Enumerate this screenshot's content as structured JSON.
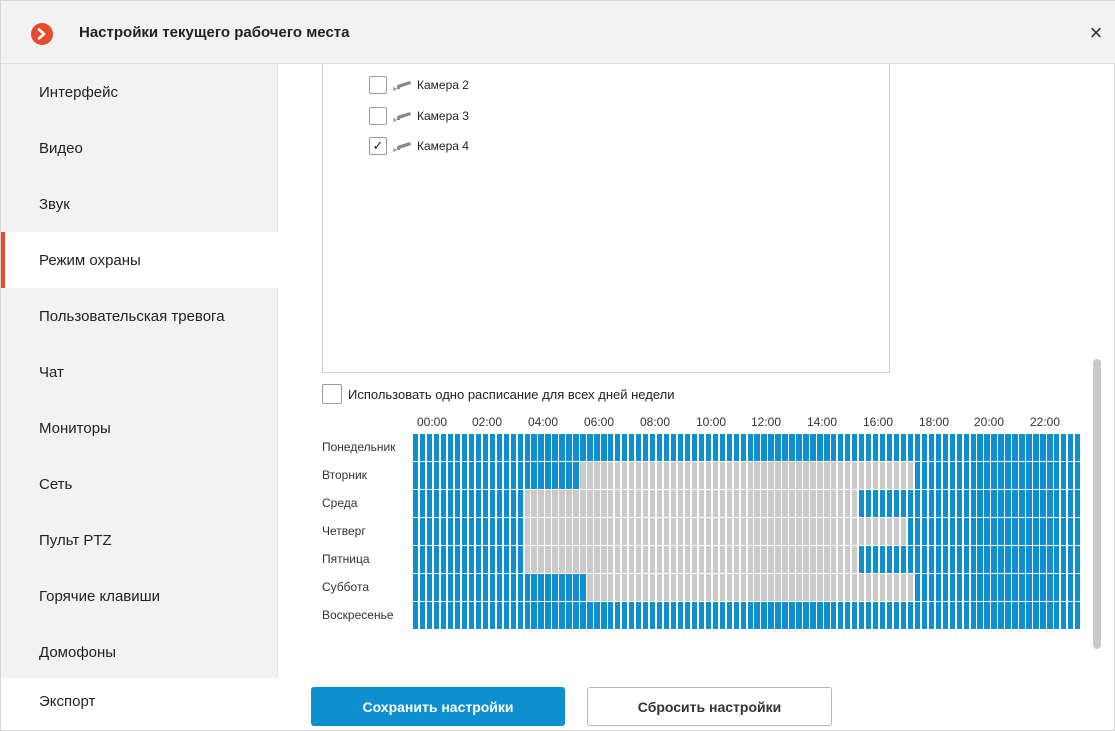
{
  "window": {
    "title": "Настройки текущего рабочего места",
    "close_glyph": "×",
    "logo_icon": "app-logo-icon",
    "accent_color": "#e84a2c"
  },
  "sidebar": {
    "items": [
      {
        "label": "Интерфейс",
        "active": false
      },
      {
        "label": "Видео",
        "active": false
      },
      {
        "label": "Звук",
        "active": false
      },
      {
        "label": "Режим охраны",
        "active": true
      },
      {
        "label": "Пользовательская тревога",
        "active": false
      },
      {
        "label": "Чат",
        "active": false
      },
      {
        "label": "Мониторы",
        "active": false
      },
      {
        "label": "Сеть",
        "active": false
      },
      {
        "label": "Пульт PTZ",
        "active": false
      },
      {
        "label": "Горячие клавиши",
        "active": false
      },
      {
        "label": "Домофоны",
        "active": false
      }
    ],
    "export_label": "Экспорт"
  },
  "cameras": [
    {
      "label": "Камера 2",
      "checked": false,
      "icon": "camera-icon"
    },
    {
      "label": "Камера 3",
      "checked": false,
      "icon": "camera-icon"
    },
    {
      "label": "Камера 4",
      "checked": true,
      "icon": "camera-icon"
    }
  ],
  "schedule": {
    "same_for_all_label": "Использовать одно расписание для всех дней недели",
    "same_for_all_checked": false,
    "hour_labels": [
      "00:00",
      "02:00",
      "04:00",
      "06:00",
      "08:00",
      "10:00",
      "12:00",
      "14:00",
      "16:00",
      "18:00",
      "20:00",
      "22:00"
    ],
    "slots_per_hour": 4,
    "active_color": "#0d8fd0",
    "inactive_color": "#cacaca",
    "days": [
      {
        "label": "Понедельник",
        "inactive_ranges": []
      },
      {
        "label": "Вторник",
        "inactive_ranges": [
          [
            6.0,
            18.0
          ]
        ]
      },
      {
        "label": "Среда",
        "inactive_ranges": [
          [
            4.0,
            16.0
          ]
        ]
      },
      {
        "label": "Четверг",
        "inactive_ranges": [
          [
            4.0,
            17.75
          ]
        ]
      },
      {
        "label": "Пятница",
        "inactive_ranges": [
          [
            4.0,
            16.0
          ]
        ]
      },
      {
        "label": "Суббота",
        "inactive_ranges": [
          [
            6.25,
            18.0
          ]
        ]
      },
      {
        "label": "Воскресенье",
        "inactive_ranges": []
      }
    ]
  },
  "buttons": {
    "save_label": "Сохранить настройки",
    "reset_label": "Сбросить настройки"
  }
}
